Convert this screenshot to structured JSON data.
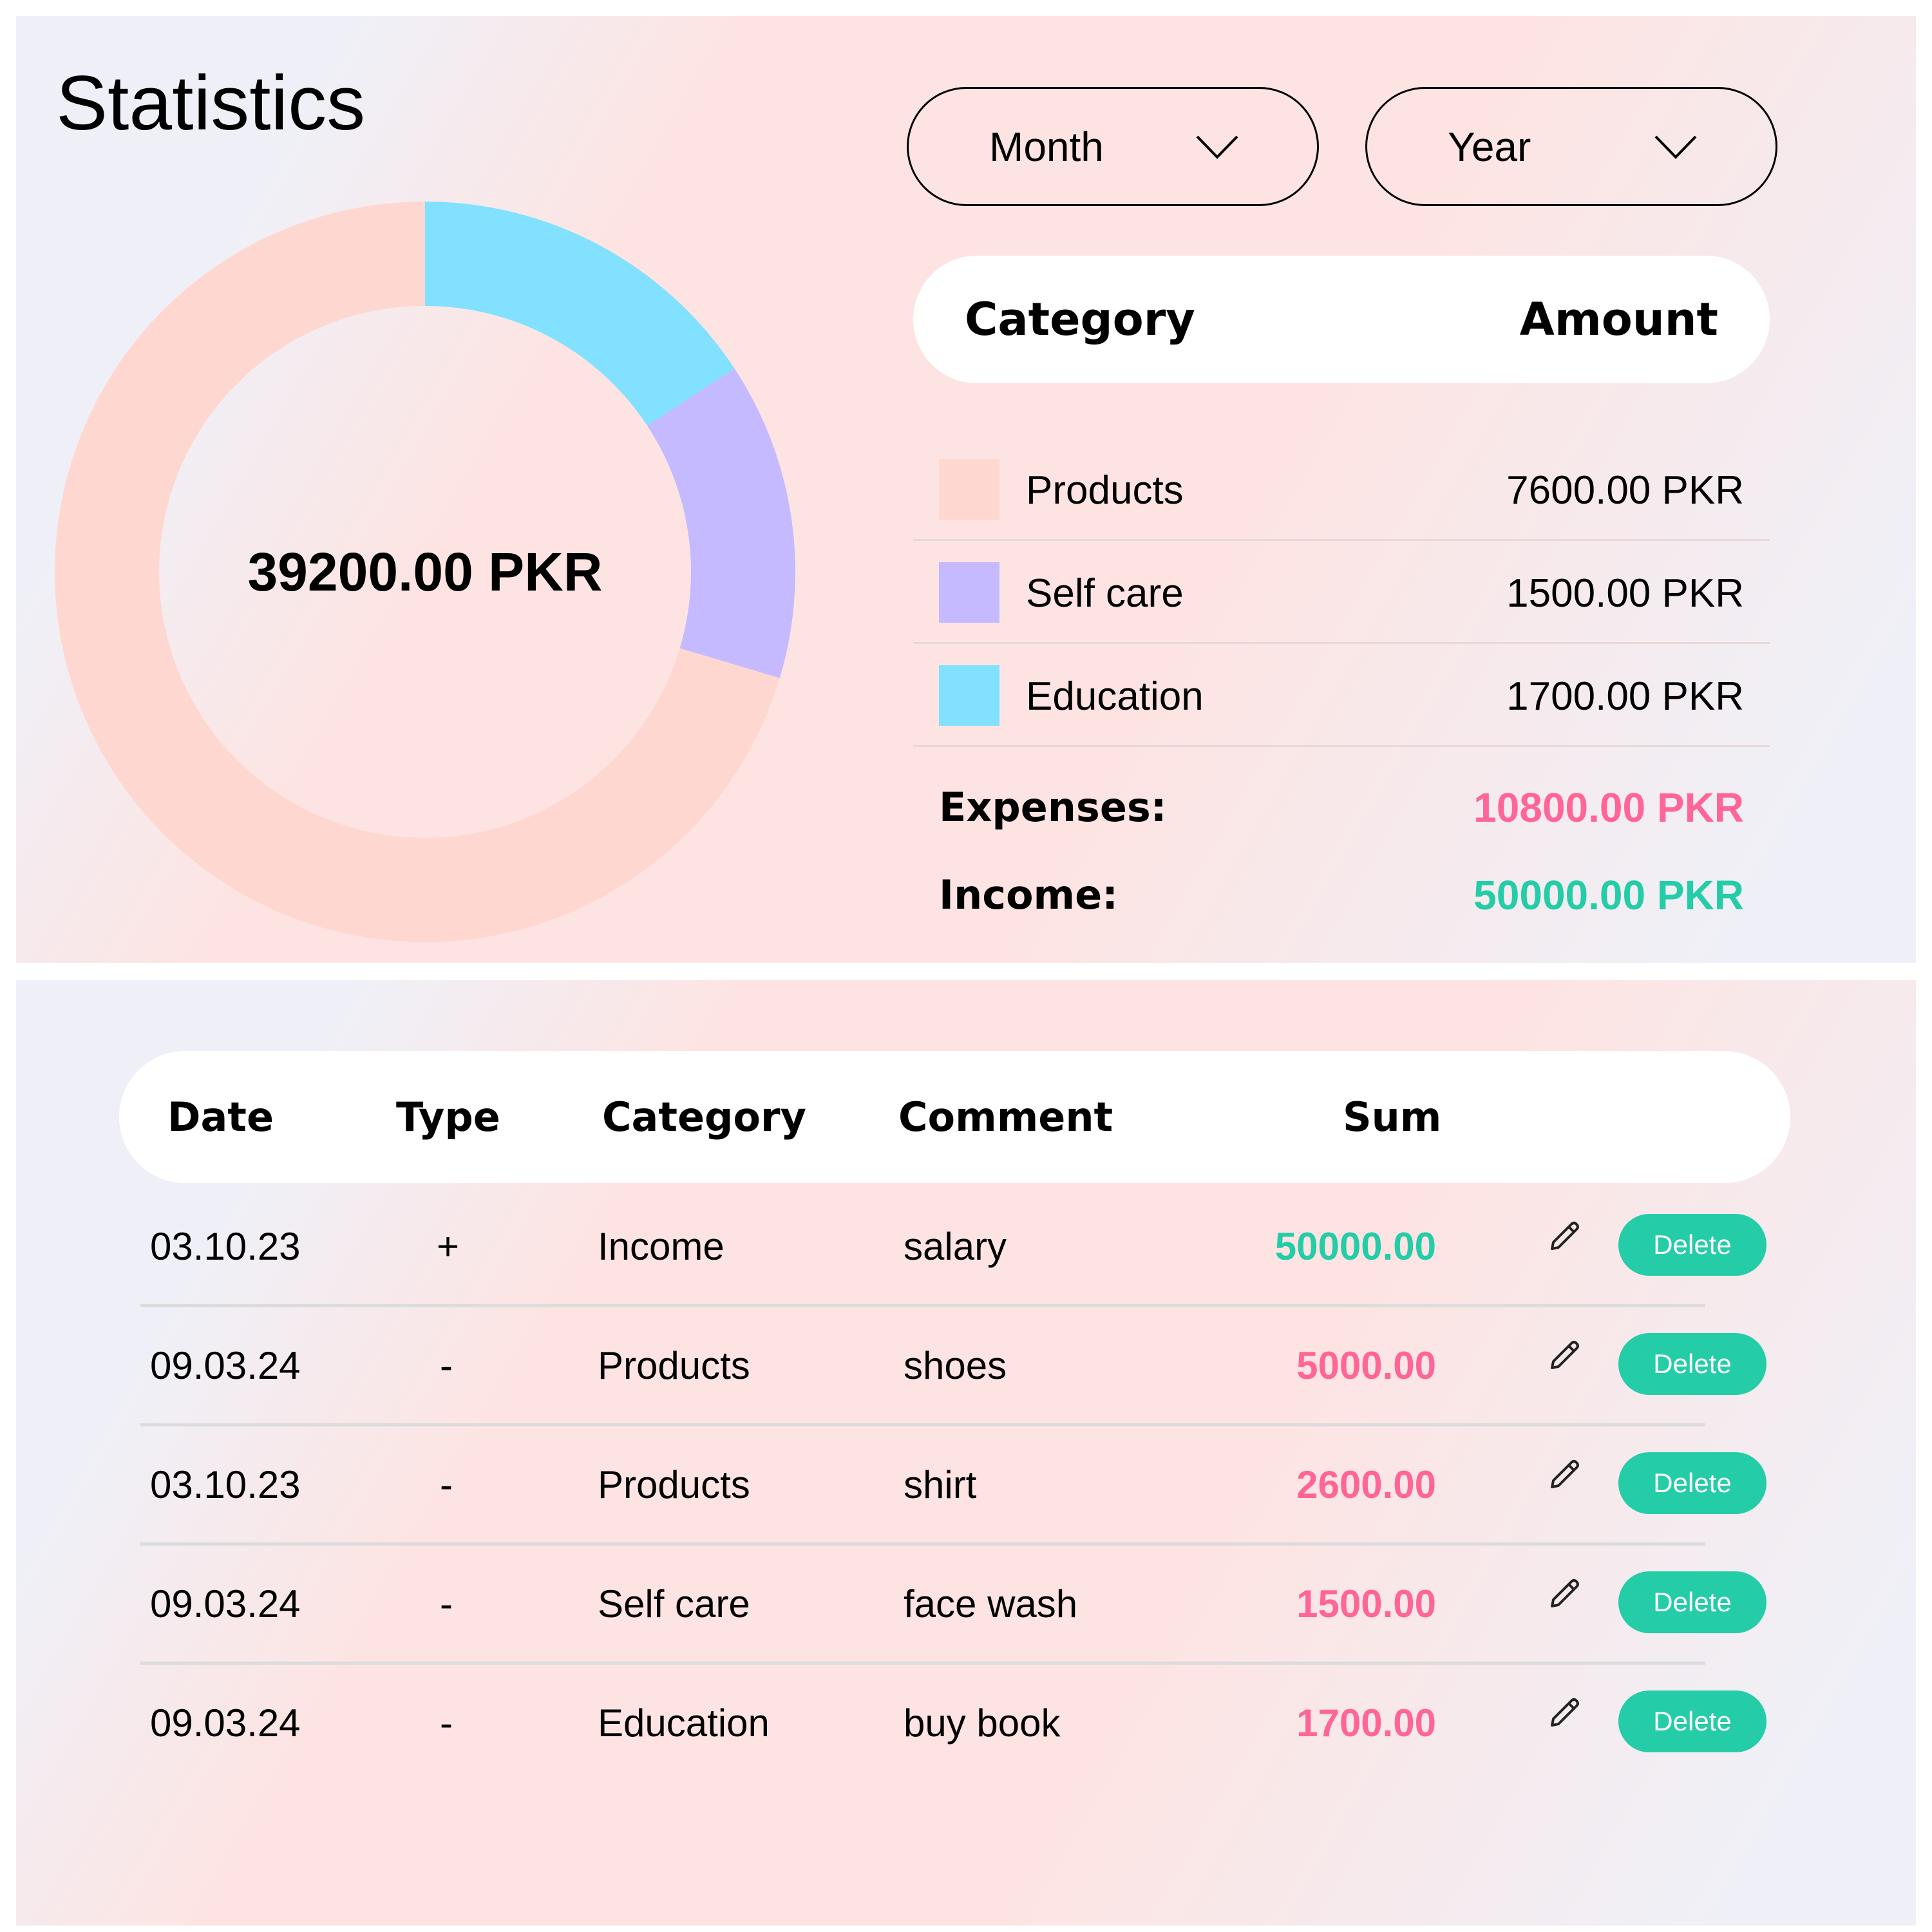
{
  "title": "Statistics",
  "filters": {
    "month_label": "Month",
    "year_label": "Year"
  },
  "categories_table": {
    "header_category": "Category",
    "header_amount": "Amount",
    "rows": [
      {
        "name": "Products",
        "amount": "7600.00 PKR",
        "color": "#fed8d0"
      },
      {
        "name": "Self care",
        "amount": "1500.00 PKR",
        "color": "#c5baff"
      },
      {
        "name": "Education",
        "amount": "1700.00 PKR",
        "color": "#81e1ff"
      }
    ],
    "expenses_label": "Expenses:",
    "expenses_value": "10800.00 PKR",
    "income_label": "Income:",
    "income_value": "50000.00 PKR"
  },
  "chart_data": {
    "type": "pie",
    "center_label": "39200.00 PKR",
    "categories": [
      "Products",
      "Self care",
      "Education"
    ],
    "values": [
      7600,
      1500,
      1700
    ],
    "colors": [
      "#fed8d0",
      "#c5baff",
      "#81e1ff"
    ]
  },
  "transactions": {
    "headers": {
      "date": "Date",
      "type": "Type",
      "category": "Category",
      "comment": "Comment",
      "sum": "Sum"
    },
    "delete_label": "Delete",
    "rows": [
      {
        "date": "03.10.23",
        "type": "+",
        "category": "Income",
        "comment": "salary",
        "sum": "50000.00",
        "kind": "income"
      },
      {
        "date": "09.03.24",
        "type": "-",
        "category": "Products",
        "comment": "shoes",
        "sum": "5000.00",
        "kind": "expense"
      },
      {
        "date": "03.10.23",
        "type": "-",
        "category": "Products",
        "comment": "shirt",
        "sum": "2600.00",
        "kind": "expense"
      },
      {
        "date": "09.03.24",
        "type": "-",
        "category": "Self care",
        "comment": "face wash",
        "sum": "1500.00",
        "kind": "expense"
      },
      {
        "date": "09.03.24",
        "type": "-",
        "category": "Education",
        "comment": "buy book",
        "sum": "1700.00",
        "kind": "expense"
      }
    ]
  },
  "colors": {
    "income": "#24cca7",
    "expense": "#ff6596",
    "accent": "#24cca7"
  },
  "icons": {
    "dropdown": "chevron-down-icon",
    "edit": "pencil-icon"
  }
}
